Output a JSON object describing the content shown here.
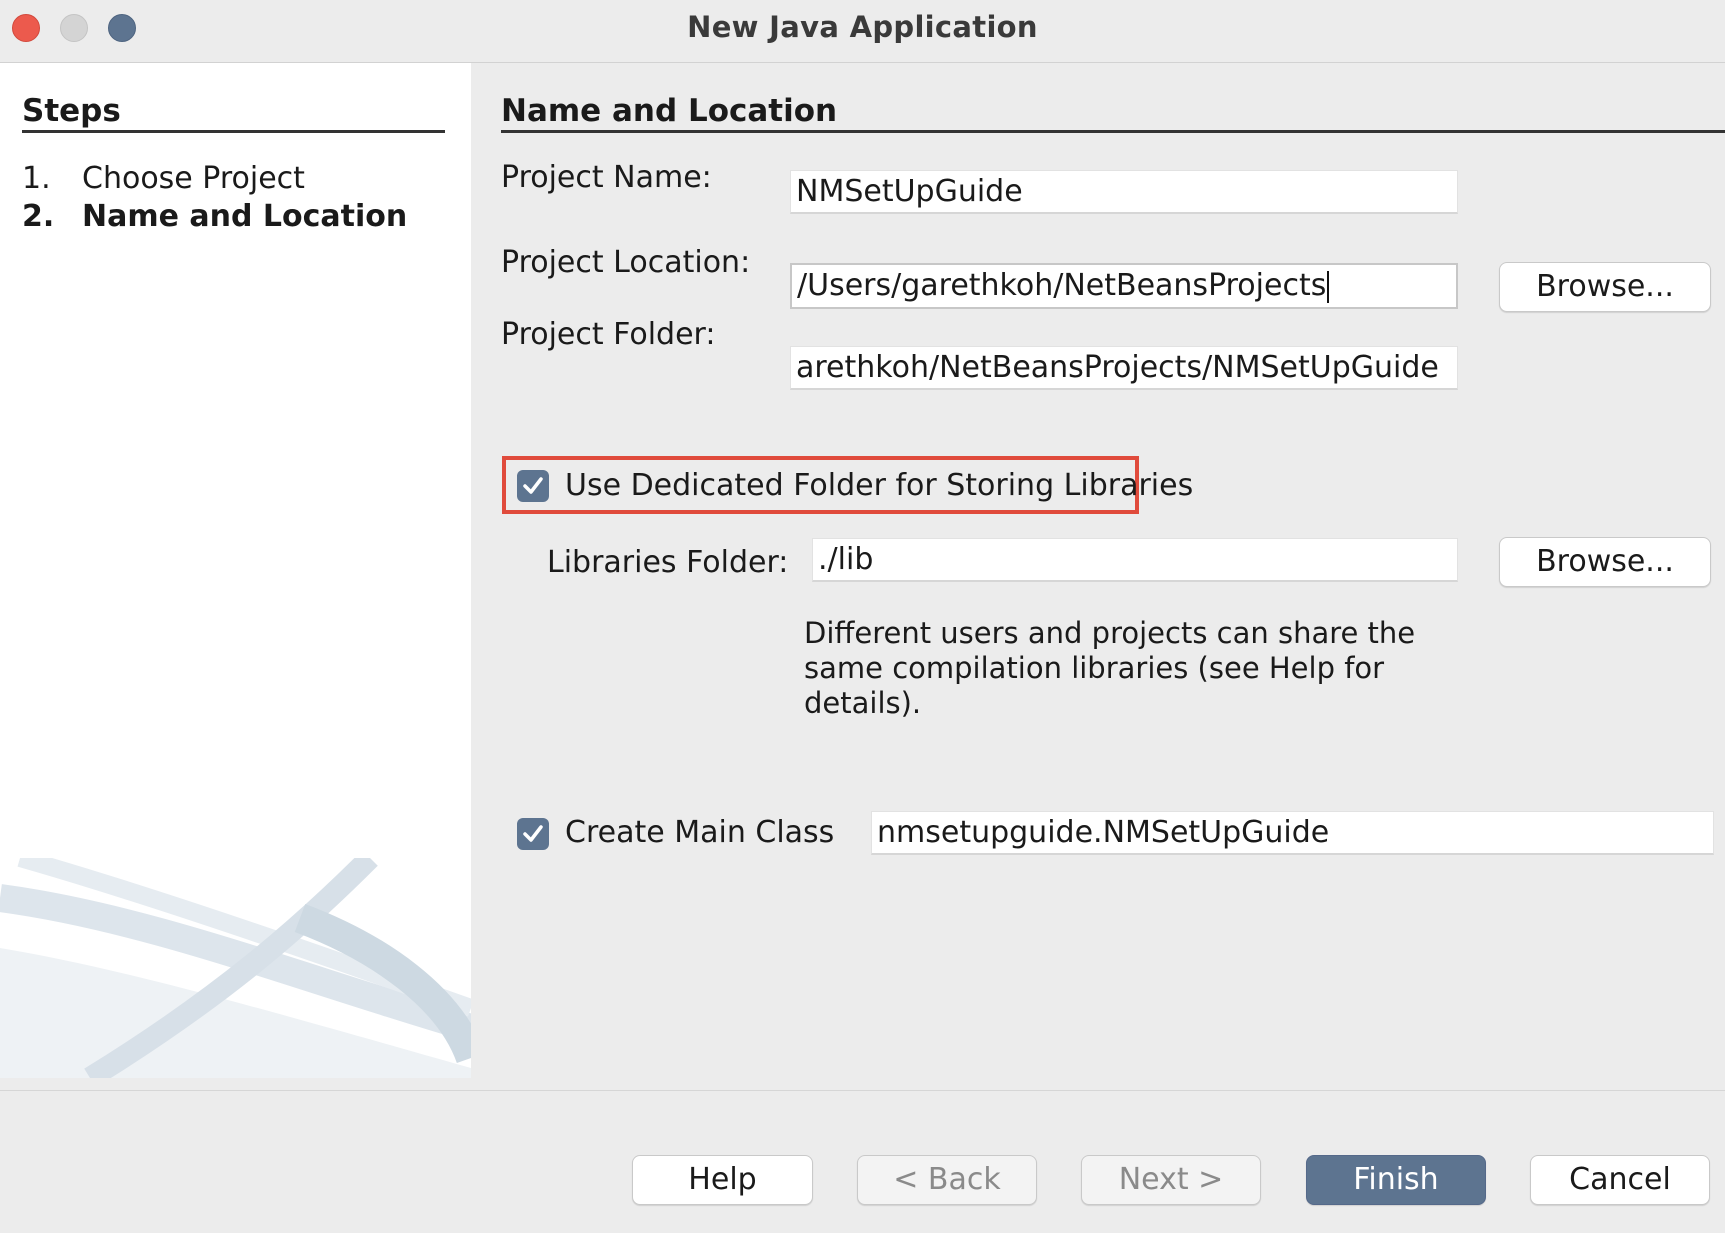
{
  "window": {
    "title": "New Java Application"
  },
  "steps": {
    "title": "Steps",
    "items": [
      {
        "number": "1.",
        "label": "Choose Project"
      },
      {
        "number": "2.",
        "label": "Name and Location"
      }
    ]
  },
  "main": {
    "section_title": "Name and Location",
    "project_name": {
      "label": "Project Name:",
      "value": "NMSetUpGuide"
    },
    "project_location": {
      "label": "Project Location:",
      "value": "/Users/garethkoh/NetBeansProjects",
      "browse_label": "Browse..."
    },
    "project_folder": {
      "label": "Project Folder:",
      "value": "arethkoh/NetBeansProjects/NMSetUpGuide"
    },
    "dedicated_folder": {
      "label": "Use Dedicated Folder for Storing Libraries",
      "checked": true
    },
    "libraries_folder": {
      "label": "Libraries Folder:",
      "value": "./lib",
      "browse_label": "Browse..."
    },
    "hint": "Different users and projects can share the same compilation libraries (see Help for details).",
    "create_main_class": {
      "label": "Create Main Class",
      "checked": true,
      "value": "nmsetupguide.NMSetUpGuide"
    }
  },
  "footer": {
    "help": "Help",
    "back": "< Back",
    "next": "Next >",
    "finish": "Finish",
    "cancel": "Cancel"
  },
  "colors": {
    "accent": "#5d7490",
    "highlight": "#e04b3c",
    "close": "#ec5a4d"
  },
  "icons": {
    "checkbox": "checkmark-icon"
  }
}
